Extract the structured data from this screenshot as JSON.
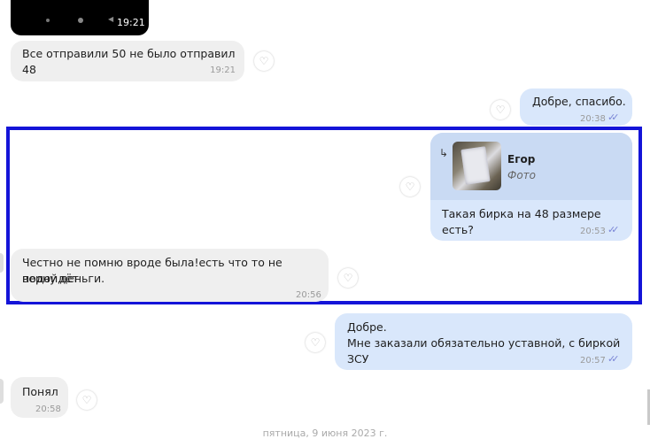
{
  "colors": {
    "outgoing_bubble": "#d9e7fb",
    "incoming_bubble": "#efefef",
    "highlight_border": "#1414d8",
    "read_ticks": "#7b86d6"
  },
  "video_card": {
    "time": "19:21",
    "icons": [
      "stop-icon",
      "record-icon",
      "play-icon"
    ]
  },
  "messages": [
    {
      "dir": "in",
      "text": "Все отправили 50 не было отправил 48",
      "time": "19:21"
    },
    {
      "dir": "out",
      "text": "Добре, спасибо.",
      "time": "20:38",
      "status": "read"
    },
    {
      "dir": "out",
      "reply": {
        "author": "Егор",
        "type": "Фото",
        "arrow": "↳"
      },
      "text": "Такая бирка на 48 размере есть?",
      "time": "20:53",
      "status": "read"
    },
    {
      "dir": "in",
      "line1": "Честно не помню вроде была!есть что то не подойдёт",
      "line2": "верну деньги.",
      "time": "20:56"
    },
    {
      "dir": "out",
      "line1": "Добре.",
      "line2": "Мне заказали обязательно уставной, с биркой ЗСУ",
      "time": "20:57",
      "status": "read"
    },
    {
      "dir": "in",
      "text": "Понял",
      "time": "20:58"
    }
  ],
  "date_separator": "пятница, 9 июня 2023 г.",
  "ticks_glyph": "✓✓",
  "heart_glyph": "♡"
}
